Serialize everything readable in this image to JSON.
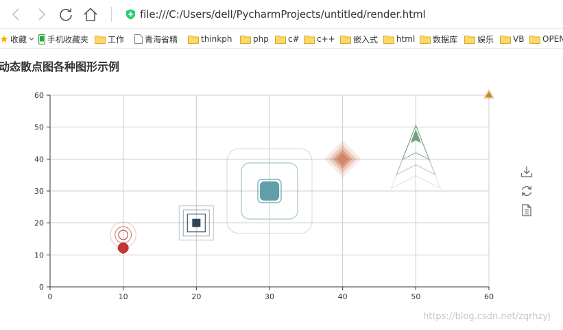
{
  "browser": {
    "url": "file:///C:/Users/dell/PycharmProjects/untitled/render.html",
    "bookmarks": [
      {
        "label": "收藏",
        "icon": "star-icon",
        "x": 0
      },
      {
        "label": "手机收藏夹",
        "icon": "phone-icon",
        "x": 56
      },
      {
        "label": "工作",
        "icon": "folder-icon",
        "x": 138
      },
      {
        "label": "青海省精",
        "icon": "page-icon",
        "x": 196
      },
      {
        "label": "thinkph",
        "icon": "folder-icon",
        "x": 274
      },
      {
        "label": "php",
        "icon": "folder-icon",
        "x": 350
      },
      {
        "label": "c#",
        "icon": "folder-icon",
        "x": 401
      },
      {
        "label": "c++",
        "icon": "folder-icon",
        "x": 443
      },
      {
        "label": "嵌入式",
        "icon": "folder-icon",
        "x": 496
      },
      {
        "label": "html",
        "icon": "folder-icon",
        "x": 559
      },
      {
        "label": "数据库",
        "icon": "folder-icon",
        "x": 612
      },
      {
        "label": "娱乐",
        "icon": "folder-icon",
        "x": 677
      },
      {
        "label": "VB",
        "icon": "folder-icon",
        "x": 729
      },
      {
        "label": "OPEN",
        "icon": "folder-icon",
        "x": 772
      }
    ]
  },
  "page": {
    "title": "动态散点图各种图形示例",
    "watermark": "https://blog.csdn.net/zqrhzyj"
  },
  "toolbox": [
    {
      "name": "save-image-icon"
    },
    {
      "name": "restore-icon"
    },
    {
      "name": "data-view-icon"
    }
  ],
  "chart_data": {
    "type": "scatter",
    "title": "动态散点图各种图形示例",
    "xlabel": "",
    "ylabel": "",
    "xlim": [
      0,
      60
    ],
    "ylim": [
      0,
      60
    ],
    "xticks": [
      0,
      10,
      20,
      30,
      40,
      50,
      60
    ],
    "yticks": [
      0,
      10,
      20,
      30,
      40,
      50,
      60
    ],
    "grid": true,
    "series": [
      {
        "symbol": "pin",
        "color": "#c23531",
        "points": [
          [
            10,
            12
          ]
        ],
        "effect": "ripple"
      },
      {
        "symbol": "rect",
        "color": "#2f4554",
        "points": [
          [
            20,
            20
          ]
        ],
        "effect": "ripple"
      },
      {
        "symbol": "roundRect",
        "color": "#61a0a8",
        "points": [
          [
            30,
            30
          ]
        ],
        "effect": "ripple"
      },
      {
        "symbol": "diamond",
        "color": "#d48265",
        "points": [
          [
            40,
            40
          ]
        ],
        "effect": "ripple"
      },
      {
        "symbol": "arrow",
        "color": "#749f83",
        "points": [
          [
            50,
            48
          ]
        ],
        "effect": "ripple"
      },
      {
        "symbol": "triangle",
        "color": "#ca8622",
        "points": [
          [
            60,
            60
          ]
        ],
        "effect": "ripple"
      }
    ]
  }
}
